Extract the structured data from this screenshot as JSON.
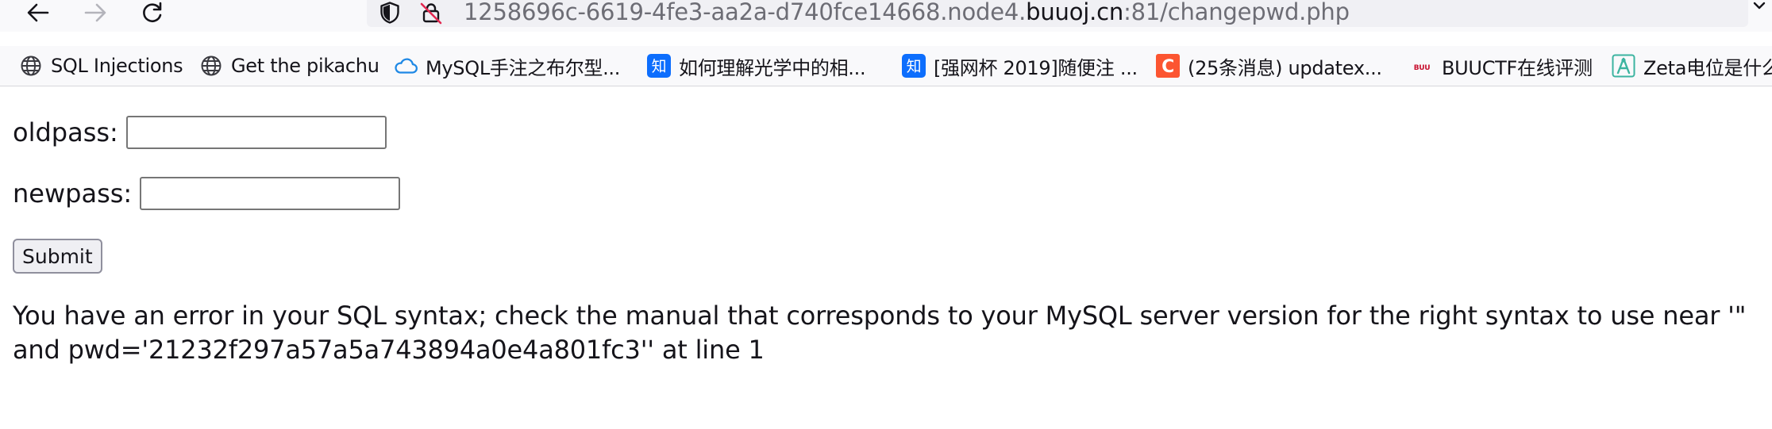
{
  "browser": {
    "url_prefix": "1258696c-6619-4fe3-aa2a-d740fce14668.node4.",
    "url_domain": "buuoj.cn",
    "url_suffix": ":81/changepwd.php"
  },
  "bookmarks": [
    {
      "label": "SQL Injections",
      "icon": "globe-icon"
    },
    {
      "label": "Get the pikachu",
      "icon": "globe-icon"
    },
    {
      "label": "MySQL手注之布尔型...",
      "icon": "cloud-icon"
    },
    {
      "label": "如何理解光学中的相...",
      "icon": "zhihu-icon",
      "favicon_text": "知"
    },
    {
      "label": "[强网杯 2019]随便注 ...",
      "icon": "zhihu-icon",
      "favicon_text": "知"
    },
    {
      "label": "(25条消息) updatex...",
      "icon": "csdn-icon",
      "favicon_text": "C"
    },
    {
      "label": "BUUCTF在线评测",
      "icon": "buuctf-icon",
      "favicon_text": "BUU"
    },
    {
      "label": "Zeta电位是什么",
      "icon": "zeta-icon"
    }
  ],
  "colors": {
    "zhihu": "#0d6efd",
    "csdn": "#fc5531",
    "buuctf": "#c8102e",
    "zeta": "#3cb4a0",
    "cloud": "#1e88e5"
  },
  "form": {
    "oldpass_label": "oldpass:",
    "oldpass_value": "",
    "newpass_label": "newpass:",
    "newpass_value": "",
    "submit_label": "Submit"
  },
  "error_message": "You have an error in your SQL syntax; check the manual that corresponds to your MySQL server version for the right syntax to use near '\" and pwd='21232f297a57a5a743894a0e4a801fc3'' at line 1"
}
